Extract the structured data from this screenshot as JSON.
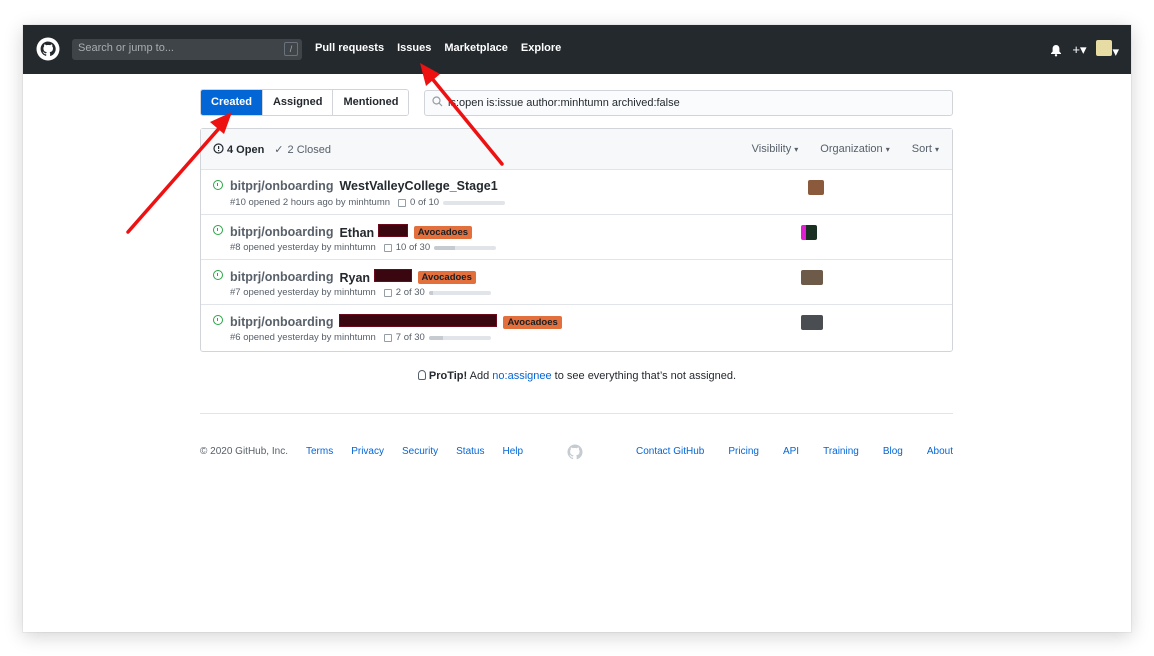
{
  "header": {
    "search_placeholder": "Search or jump to...",
    "search_shortcut": "/",
    "nav": [
      "Pull requests",
      "Issues",
      "Marketplace",
      "Explore"
    ],
    "plus": "+"
  },
  "tabs": [
    "Created",
    "Assigned",
    "Mentioned"
  ],
  "filter": {
    "query": "is:open is:issue author:minhtumn archived:false"
  },
  "states": {
    "open": "4 Open",
    "closed": "2 Closed"
  },
  "filters": [
    "Visibility",
    "Organization",
    "Sort"
  ],
  "issues": [
    {
      "repo": "bitprj/onboarding",
      "title": "WestValleyCollege_Stage1",
      "label": "",
      "meta": "#10 opened 2 hours ago by minhtumn",
      "tasks": "0 of 10",
      "progress": 0.0
    },
    {
      "repo": "bitprj/onboarding",
      "title": "Ethan",
      "label": "Avocadoes",
      "meta": "#8 opened yesterday by minhtumn",
      "tasks": "10 of 30",
      "progress": 0.333
    },
    {
      "repo": "bitprj/onboarding",
      "title": "Ryan",
      "label": "Avocadoes",
      "meta": "#7 opened yesterday by minhtumn",
      "tasks": "2 of 30",
      "progress": 0.067
    },
    {
      "repo": "bitprj/onboarding",
      "title": "",
      "label": "Avocadoes",
      "meta": "#6 opened yesterday by minhtumn",
      "tasks": "7 of 30",
      "progress": 0.233
    }
  ],
  "protip": {
    "lead": "ProTip!",
    "pre": "Add",
    "link": "no:assignee",
    "post": "to see everything that’s not assigned."
  },
  "footer": {
    "left": [
      "© 2020 GitHub, Inc.",
      "Terms",
      "Privacy",
      "Security",
      "Status",
      "Help"
    ],
    "right": [
      "Contact GitHub",
      "Pricing",
      "API",
      "Training",
      "Blog",
      "About"
    ]
  },
  "colors": {
    "header": "#24292e",
    "accent": "#0366d6",
    "label": "#e3703c",
    "arrow": "#ee1111",
    "open": "#28a745"
  }
}
